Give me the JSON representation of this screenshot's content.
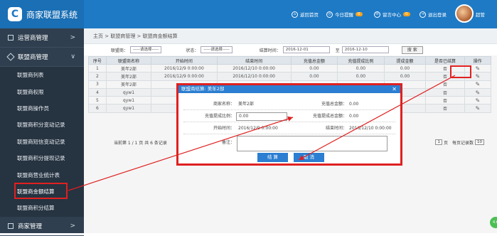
{
  "app": {
    "logo_char": "C",
    "title": "商家联盟系统"
  },
  "topnav": [
    {
      "label": "返回首页",
      "icon": "home-icon"
    },
    {
      "label": "今日提醒",
      "badge": "0",
      "icon": "clock-icon"
    },
    {
      "label": "留言中心",
      "badge": "0",
      "icon": "message-icon"
    },
    {
      "label": "退出登录",
      "icon": "logout-icon"
    }
  ],
  "user": {
    "name": "超管"
  },
  "sidebar": {
    "groups": [
      {
        "label": "运营商管理",
        "icon": "monitor-icon"
      },
      {
        "label": "联盟商管理",
        "icon": "diamond-icon"
      },
      {
        "label": "商家管理",
        "icon": "monitor-icon"
      }
    ],
    "items": [
      "联盟商列表",
      "联盟商权限",
      "联盟商操作员",
      "联盟商积分变动记录",
      "联盟商短信变动记录",
      "联盟商积分提现记录",
      "联盟商营业统计表",
      "联盟商金额结算",
      "联盟商积分结算"
    ]
  },
  "breadcrumb": "主页  >  联盟商管理  >  联盟商金额结算",
  "filters": {
    "label1": "联盟商：",
    "select1": "-----请选择-----",
    "label2": "状态：",
    "select2": "-----请选择-----",
    "label3": "结算时间：",
    "date_from": "2016-12-01",
    "to": "至",
    "date_to": "2016-12-10",
    "search_btn": "搜 索"
  },
  "table": {
    "headers": [
      "序号",
      "联盟商名称",
      "开始时间",
      "结束时间",
      "充值总金额",
      "充值提成比例",
      "提成金额",
      "是否已结算",
      "操作"
    ],
    "rows": [
      [
        "1",
        "美年2部",
        "2016/12/9 0:00:00",
        "2016/12/10 0:00:00",
        "0.00",
        "0.00",
        "0.00",
        "否"
      ],
      [
        "2",
        "美年2部",
        "2016/12/9 0:00:00",
        "2016/12/10 0:00:00",
        "0.00",
        "0.00",
        "0.00",
        "否"
      ],
      [
        "3",
        "美年2部",
        "",
        "",
        "",
        "",
        "",
        "否"
      ],
      [
        "4",
        "qyw1",
        "",
        "",
        "",
        "",
        "",
        "否"
      ],
      [
        "5",
        "qyw1",
        "",
        "",
        "",
        "",
        "",
        "否"
      ],
      [
        "6",
        "qyw1",
        "",
        "",
        "",
        "",
        "",
        "否"
      ]
    ]
  },
  "pager": {
    "left": "当前第 1 / 1 页  共 6 条记录",
    "first_page": "1",
    "page_label": "页",
    "per_page_label": "每页记录数",
    "per_page": "10"
  },
  "dialog": {
    "title": "联盟商结算: 美年2部",
    "close": "✕",
    "merchant_label": "商家名称：",
    "merchant_value": "美年2部",
    "total_label": "充值总金额：",
    "total_value": "0.00",
    "ratio_label": "充值提成比例：",
    "ratio_value": "0.00",
    "commission_label": "充值提成总金额：",
    "commission_value": "0.00",
    "start_label": "开始时间：",
    "start_value": "2016/12/9 0:00:00",
    "end_label": "结束时间：",
    "end_value": "2016/12/10 0:00:00",
    "remark_label": "备注：",
    "confirm": "结 算",
    "cancel": "取 消"
  },
  "fab_text": "4.6",
  "colors": {
    "primary": "#1e7ac5",
    "sidebar": "#2f3f4f",
    "highlight": "#e02020",
    "badge": "#f7a21b"
  }
}
